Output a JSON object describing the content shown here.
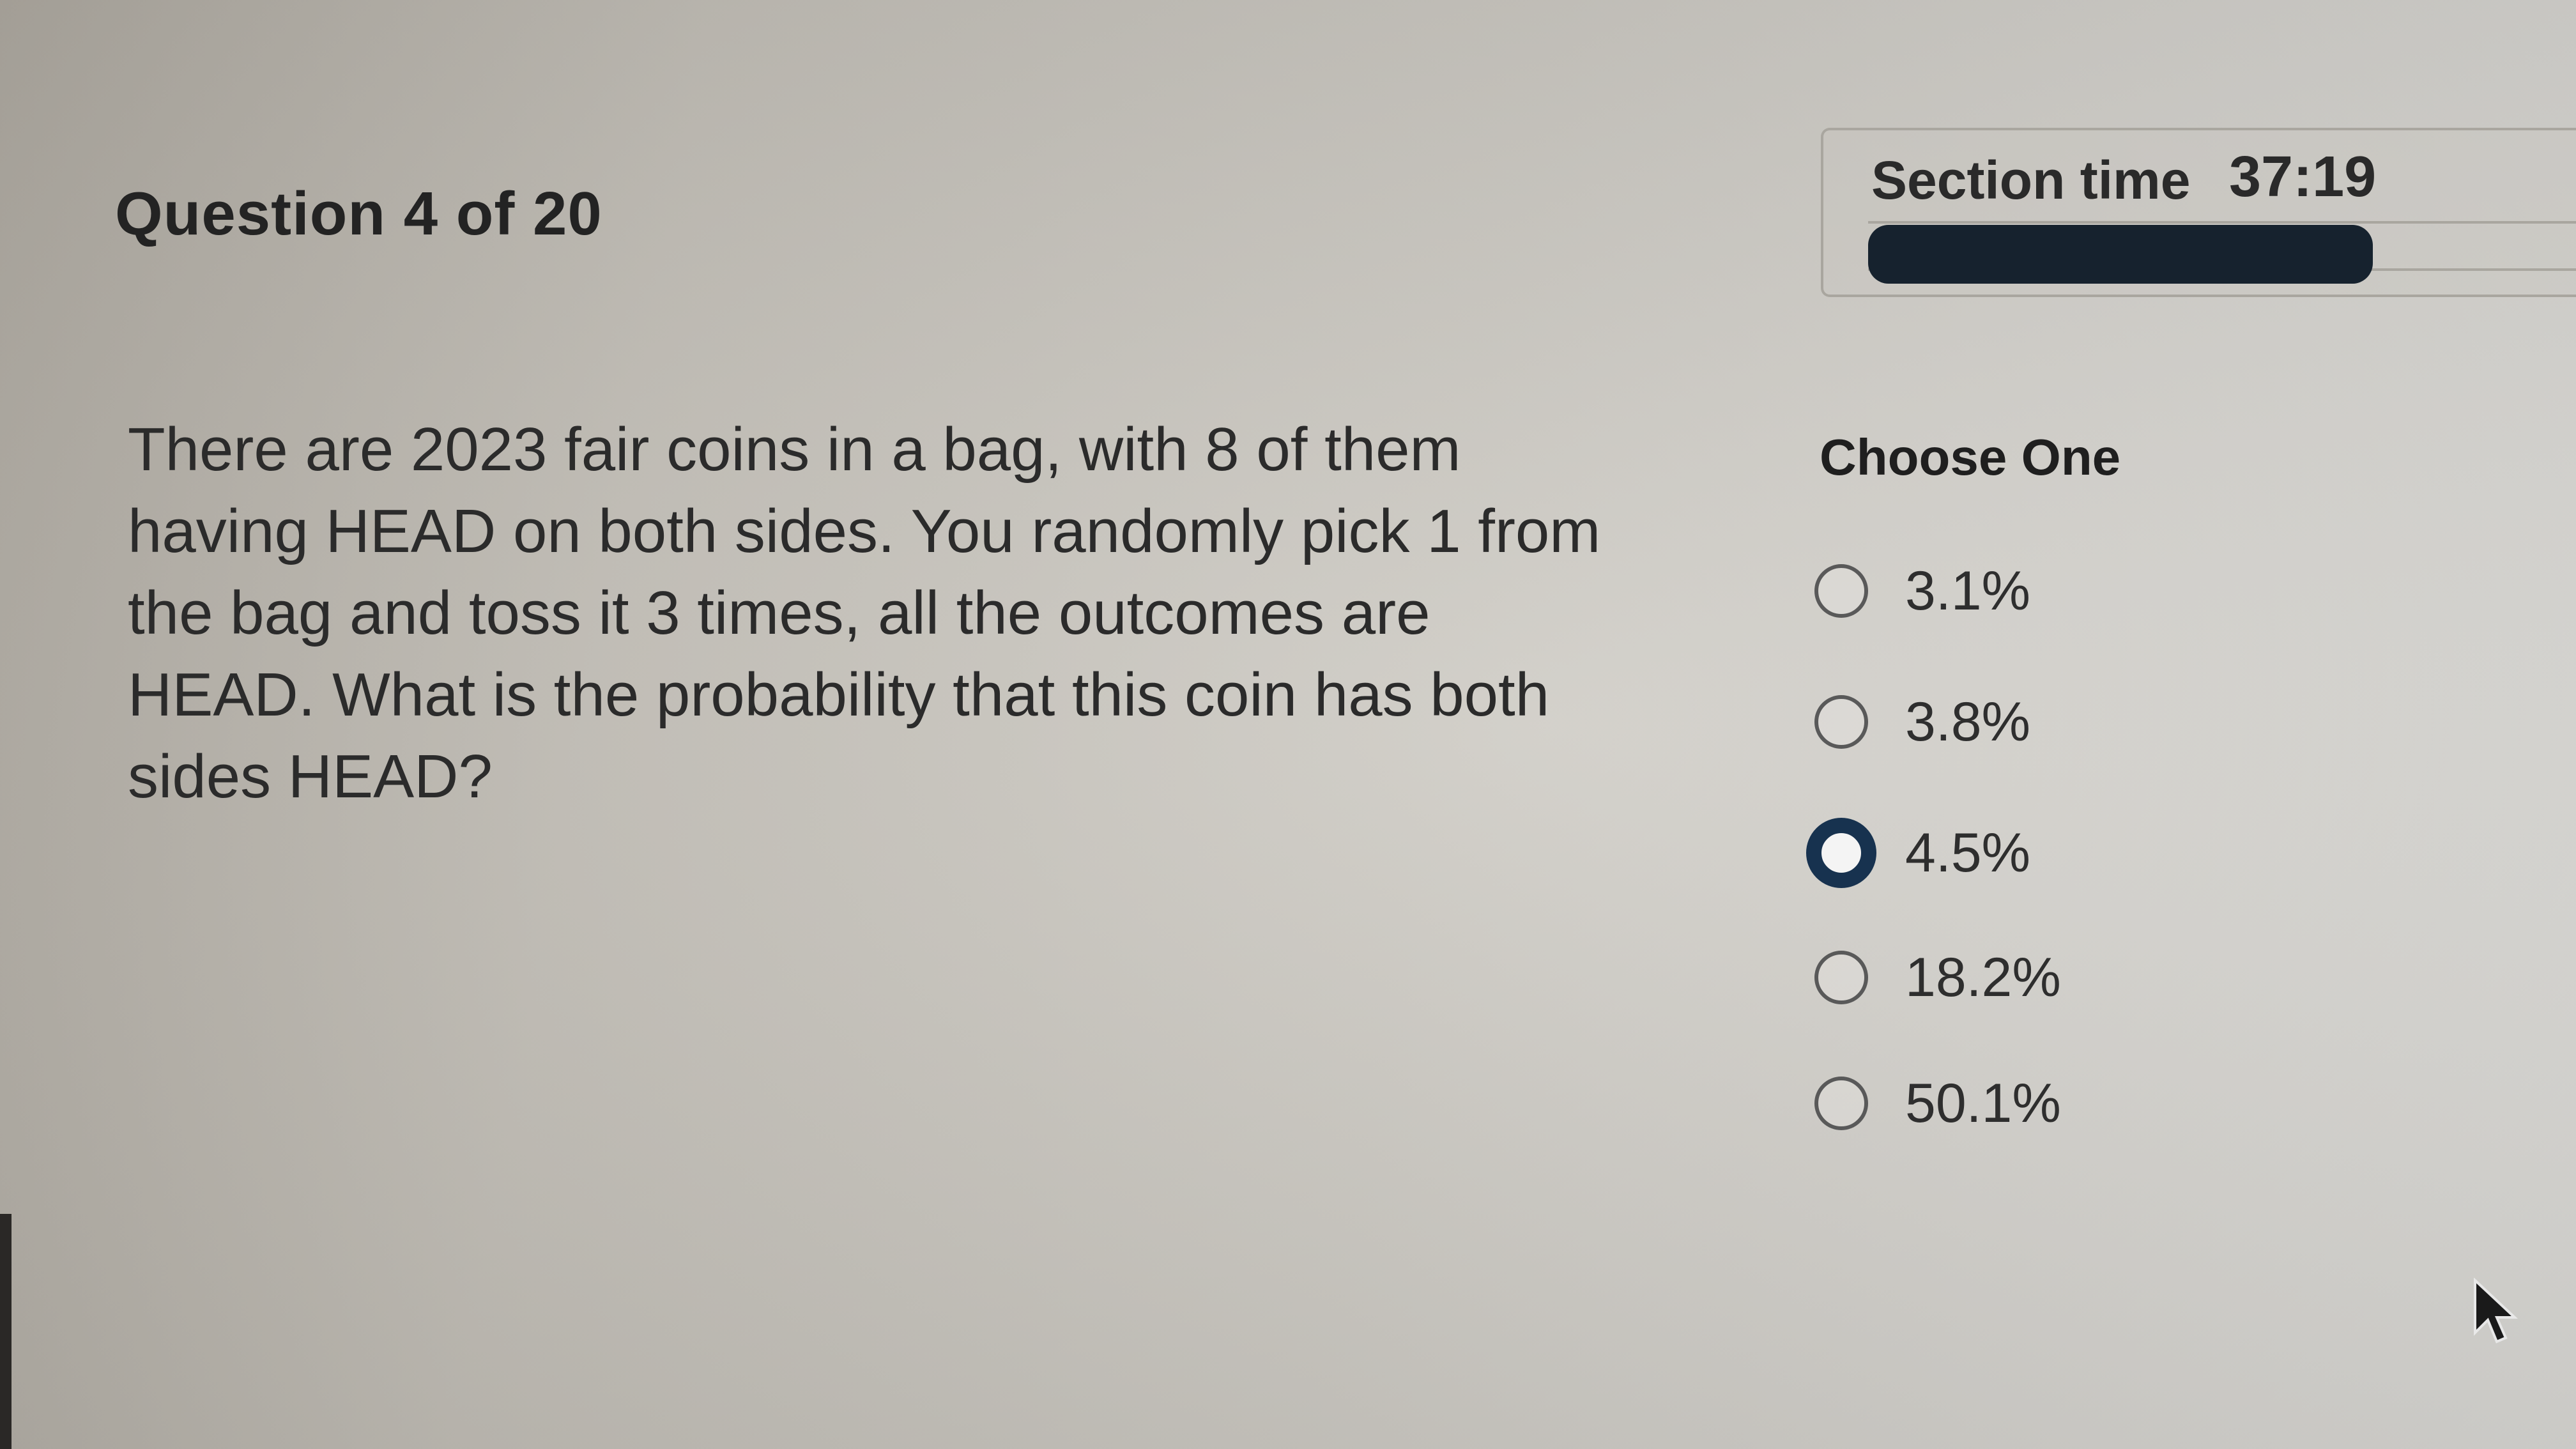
{
  "header": {
    "question_counter": "Question 4 of 20"
  },
  "timer": {
    "label": "Section time",
    "value": "37:19",
    "progress_fraction": 0.76
  },
  "question": {
    "text": "There are 2023 fair coins in a bag, with 8 of them\nhaving HEAD on both sides. You randomly pick 1 from\nthe bag and toss it 3 times, all the outcomes are\nHEAD. What is the probability that this coin has both\nsides HEAD?"
  },
  "answers": {
    "prompt": "Choose One",
    "options": [
      {
        "label": "3.1%",
        "selected": false
      },
      {
        "label": "3.8%",
        "selected": false
      },
      {
        "label": "4.5%",
        "selected": true
      },
      {
        "label": "18.2%",
        "selected": false
      },
      {
        "label": "50.1%",
        "selected": false
      }
    ]
  },
  "colors": {
    "progress_fill": "#16222e",
    "selected_radio": "#17324f"
  },
  "icons": {
    "cursor": "mouse-pointer-arrow-icon"
  }
}
